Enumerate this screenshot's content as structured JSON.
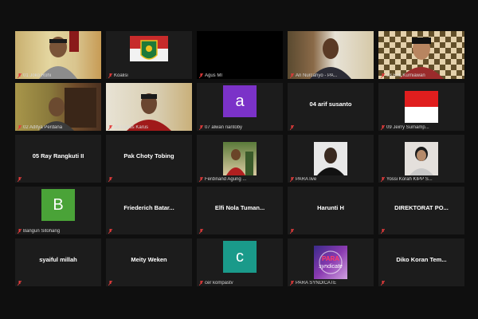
{
  "participants": [
    {
      "name": "01 Joko Rohi",
      "active": true,
      "kind": "video"
    },
    {
      "name": "Koalisi",
      "kind": "logo"
    },
    {
      "name": "Agus MI",
      "kind": "black"
    },
    {
      "name": "Ari Nurcahyo - PA...",
      "kind": "video"
    },
    {
      "name": "03 Erik Kurniawan",
      "kind": "video"
    },
    {
      "name": "02 Aditya Perdana",
      "kind": "video"
    },
    {
      "name": "06 Lucius Karus",
      "kind": "video"
    },
    {
      "name": "07 alwan riantoby",
      "kind": "letter",
      "letter": "a",
      "color": "#7b32c8"
    },
    {
      "name": "",
      "big_name": "04 arif susanto",
      "kind": "name"
    },
    {
      "name": "09 Jeirry Sumamp...",
      "kind": "flag"
    },
    {
      "name": "",
      "big_name": "05 Ray Rangkuti II",
      "kind": "name"
    },
    {
      "name": "",
      "big_name": "Pak Choty Tobing",
      "kind": "name"
    },
    {
      "name": "Ferdinand Agung ...",
      "kind": "photo"
    },
    {
      "name": "PARA live",
      "kind": "photo"
    },
    {
      "name": "Yossi Korah KIPP S...",
      "kind": "photo"
    },
    {
      "name": "Bangun Sitohang",
      "kind": "letter",
      "letter": "B",
      "color": "#4aa338"
    },
    {
      "name": "",
      "big_name": "Friederich Batar...",
      "kind": "name"
    },
    {
      "name": "",
      "big_name": "Elfi Nola Tuman...",
      "kind": "name"
    },
    {
      "name": "",
      "big_name": "Harunti H",
      "kind": "name"
    },
    {
      "name": "",
      "big_name": "DIREKTORAT PO...",
      "kind": "name"
    },
    {
      "name": "",
      "big_name": "syaiful millah",
      "kind": "name"
    },
    {
      "name": "",
      "big_name": "Meity Weken",
      "kind": "name"
    },
    {
      "name": "cer kompastv",
      "kind": "letter",
      "letter": "c",
      "color": "#1a9a8a"
    },
    {
      "name": "PARA SYNDICATE",
      "kind": "logo2"
    },
    {
      "name": "",
      "big_name": "Diko Koran Tem...",
      "kind": "name"
    }
  ]
}
